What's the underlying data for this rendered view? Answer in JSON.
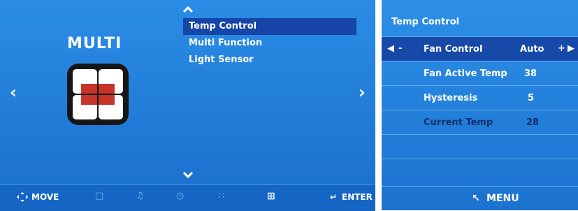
{
  "left_screen": {
    "title": "MULTI",
    "menu": [
      {
        "label": "Temp Control",
        "selected": true
      },
      {
        "label": "Multi Function",
        "selected": false
      },
      {
        "label": "Light Sensor",
        "selected": false
      }
    ],
    "bottom_bar": {
      "move_label": "MOVE",
      "enter_label": "ENTER",
      "icons": [
        "monitor-icon",
        "music-icon",
        "clock-icon",
        "grid-icon",
        "multi-window-icon"
      ],
      "active_icon": "multi-window-icon"
    }
  },
  "right_screen": {
    "title": "Temp Control",
    "rows": [
      {
        "label": "Fan Control",
        "value": "Auto",
        "selected": true,
        "enabled": true
      },
      {
        "label": "Fan Active Temp",
        "value": "38",
        "selected": false,
        "enabled": true
      },
      {
        "label": "Hysteresis",
        "value": "5",
        "selected": false,
        "enabled": true
      },
      {
        "label": "Current Temp",
        "value": "28",
        "selected": false,
        "enabled": false
      }
    ],
    "minus_label": "-",
    "plus_label": "+",
    "footer_label": "MENU"
  },
  "colors": {
    "panel_blue": "#1f7cd8",
    "selection": "#1545a6",
    "disabled_text": "#0e2f6e",
    "icon_red": "#c6342a"
  }
}
